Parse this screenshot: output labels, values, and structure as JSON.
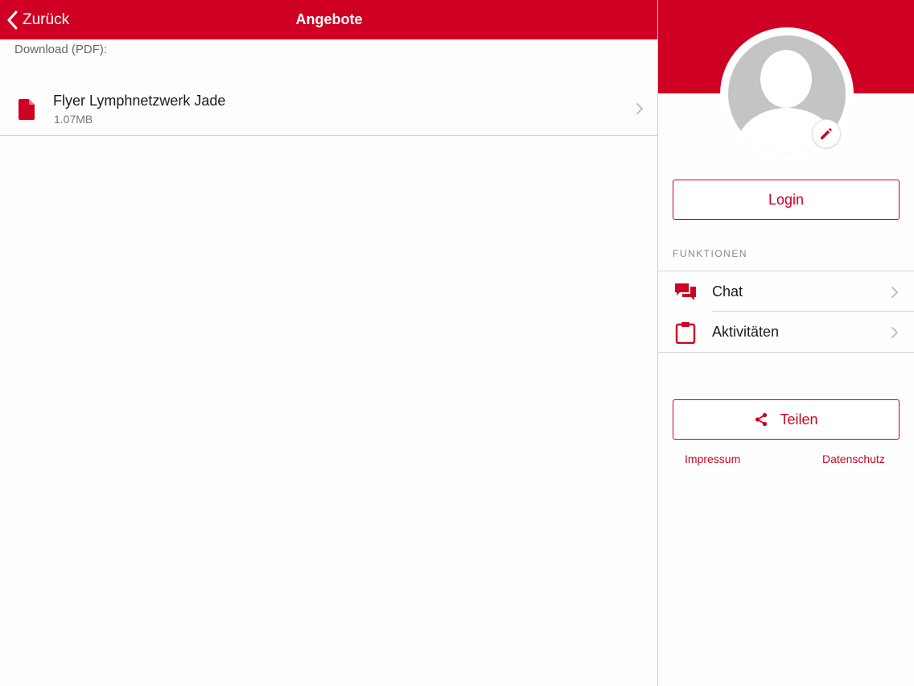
{
  "colors": {
    "accent": "#cf0023",
    "divider": "#d6d6d6"
  },
  "navbar": {
    "back_label": "Zurück",
    "title": "Angebote"
  },
  "content": {
    "section_label": "Download (PDF):",
    "files": [
      {
        "name": "Flyer Lymphnetzwerk Jade",
        "size": "1.07MB",
        "icon": "file-icon"
      }
    ]
  },
  "side": {
    "avatar_icon": "avatar-placeholder",
    "edit_icon": "pencil-icon",
    "login_label": "Login",
    "functions_heading": "FUNKTIONEN",
    "menu": [
      {
        "label": "Chat",
        "icon": "chat-icon"
      },
      {
        "label": "Aktivitäten",
        "icon": "clipboard-icon"
      }
    ],
    "share_label": "Teilen",
    "share_icon": "share-icon",
    "links": {
      "impressum": "Impressum",
      "datenschutz": "Datenschutz"
    }
  }
}
